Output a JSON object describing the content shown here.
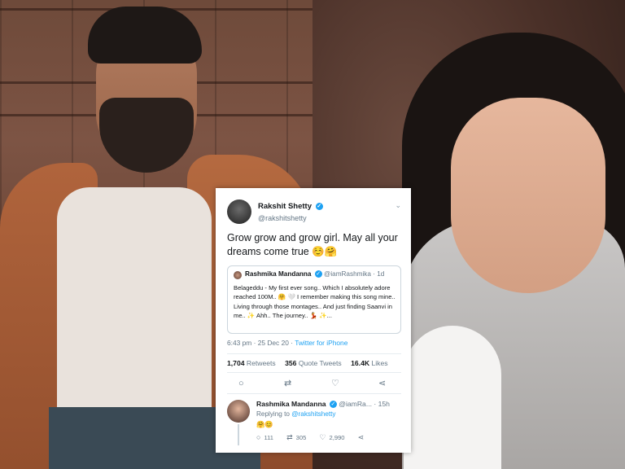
{
  "tweet": {
    "author_name": "Rakshit Shetty",
    "author_handle": "@rakshitshetty",
    "verified_mark": "✓",
    "caret": "⌄",
    "text": "Grow grow and grow girl. May all your dreams come true ☺️🤗",
    "quote": {
      "author_name": "Rashmika Mandanna",
      "author_handle": "@iamRashmika · 1d",
      "text": "Belageddu - My first ever song.. Which I absolutely adore reached 100M.. 🤗 🤍 I remember making this song mine.. Living through those montages.. And just finding Saanvi in me.. ✨ Ahh.. The journey.. 💃 ✨..."
    },
    "timestamp": "6:43 pm · 25 Dec 20 · ",
    "source": "Twitter for iPhone",
    "stats": {
      "retweets_count": "1,704",
      "retweets_label": "Retweets",
      "quotes_count": "356",
      "quotes_label": "Quote Tweets",
      "likes_count": "16.4K",
      "likes_label": "Likes"
    },
    "action_icons": {
      "reply": "○",
      "retweet": "⇄",
      "like": "♡",
      "share": "⋖"
    }
  },
  "reply": {
    "author_name": "Rashmika Mandanna",
    "author_handle": "@iamRa... · 15h",
    "replying_prefix": "Replying to ",
    "replying_to": "@rakshitshetty",
    "text": "🤗😊",
    "reply_count": "111",
    "retweet_count": "305",
    "like_count": "2,990"
  },
  "colors": {
    "link": "#1da1f2",
    "muted": "#657786",
    "text": "#14171a"
  }
}
